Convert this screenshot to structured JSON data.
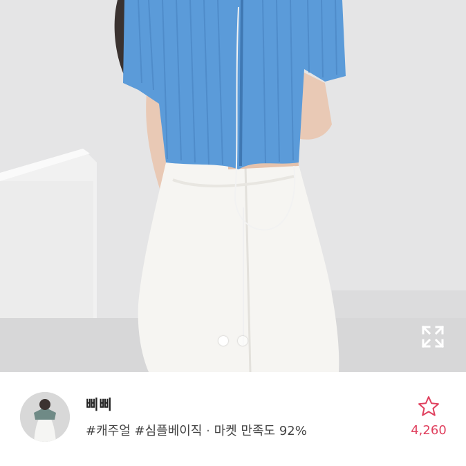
{
  "shop": {
    "name": "삐삐",
    "tags": [
      "#캐주얼",
      "#심플베이직"
    ],
    "separator": "·",
    "satisfaction": "마켓 만족도 92%"
  },
  "favorite": {
    "count": "4,260",
    "icon": "star-outline-icon"
  },
  "gallery": {
    "total_dots": 2,
    "active_index": 0,
    "expand_icon": "expand-icon"
  },
  "colors": {
    "accent": "#e0405e",
    "cardigan": "#5b9bd9",
    "background": "#e4e4e5"
  }
}
